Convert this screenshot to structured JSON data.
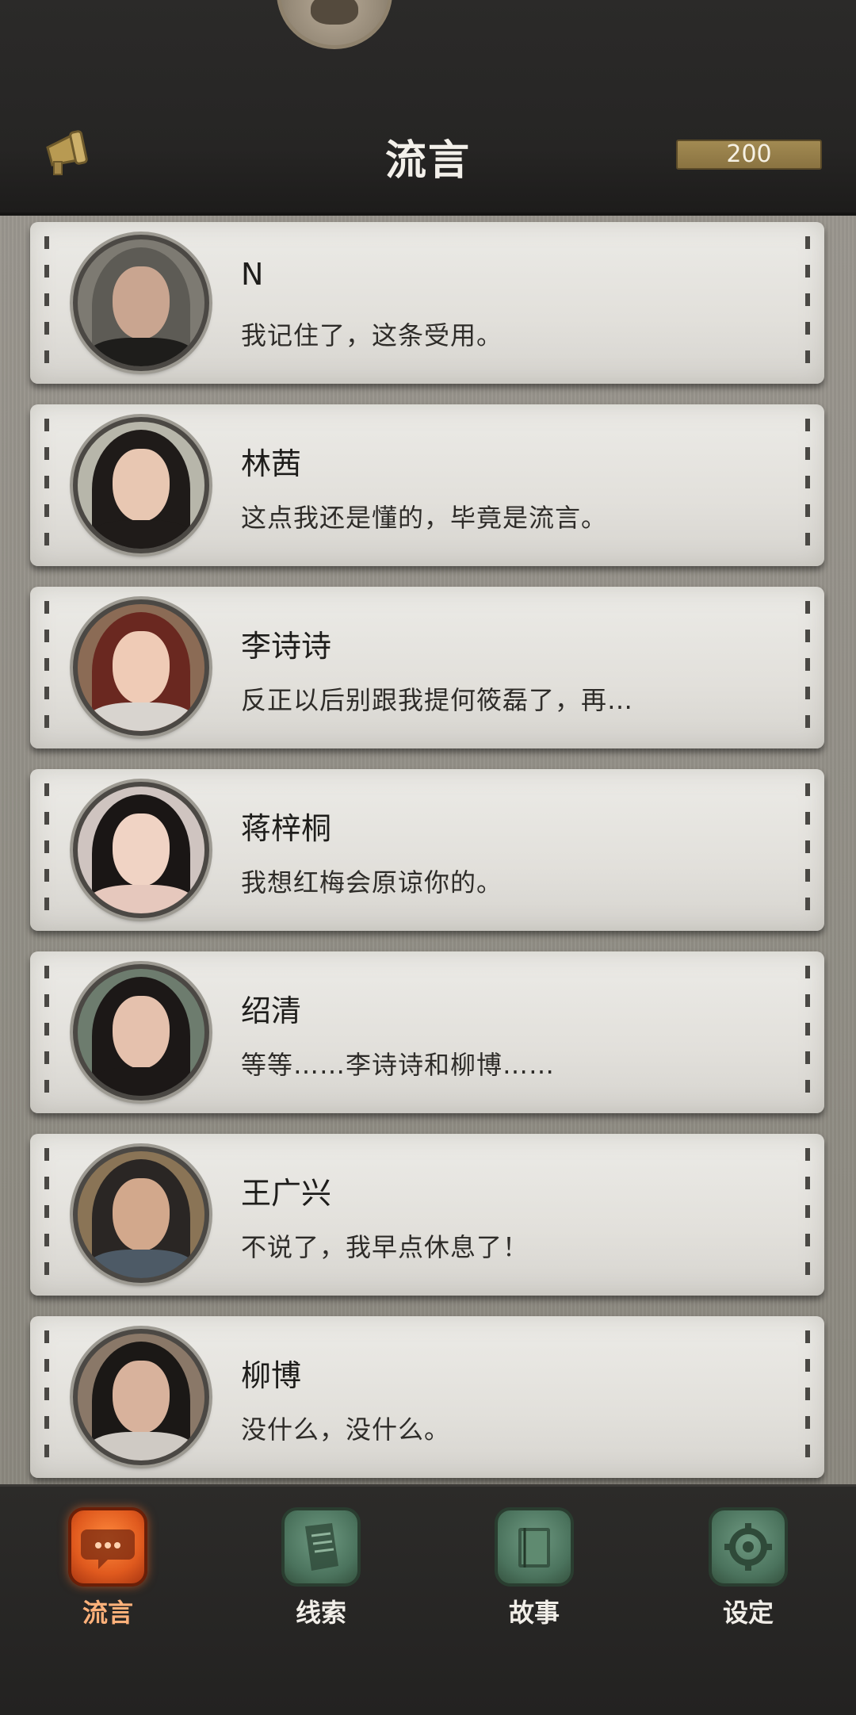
{
  "header": {
    "title": "流言",
    "coins": "200",
    "left_icon": "megaphone-icon"
  },
  "rumors": [
    {
      "name": "N",
      "message": "我记住了，这条受用。",
      "avatar_tone": "#3b3a36"
    },
    {
      "name": "林茜",
      "message": "这点我还是懂的，毕竟是流言。",
      "avatar_tone": "#2a2522"
    },
    {
      "name": "李诗诗",
      "message": "反正以后别跟我提何筱磊了，再…",
      "avatar_tone": "#6b2e28"
    },
    {
      "name": "蒋梓桐",
      "message": "我想红梅会原谅你的。",
      "avatar_tone": "#1f1b1a"
    },
    {
      "name": "绍清",
      "message": "等等……李诗诗和柳博……",
      "avatar_tone": "#221d1c"
    },
    {
      "name": "王广兴",
      "message": "不说了，我早点休息了！",
      "avatar_tone": "#2c2a2b"
    },
    {
      "name": "柳博",
      "message": "没什么，没什么。",
      "avatar_tone": "#1d1a18"
    }
  ],
  "nav": [
    {
      "label": "流言",
      "icon": "chat-bubble-icon",
      "active": true
    },
    {
      "label": "线索",
      "icon": "paper-notes-icon",
      "active": false
    },
    {
      "label": "故事",
      "icon": "book-icon",
      "active": false
    },
    {
      "label": "设定",
      "icon": "gear-icon",
      "active": false
    }
  ]
}
